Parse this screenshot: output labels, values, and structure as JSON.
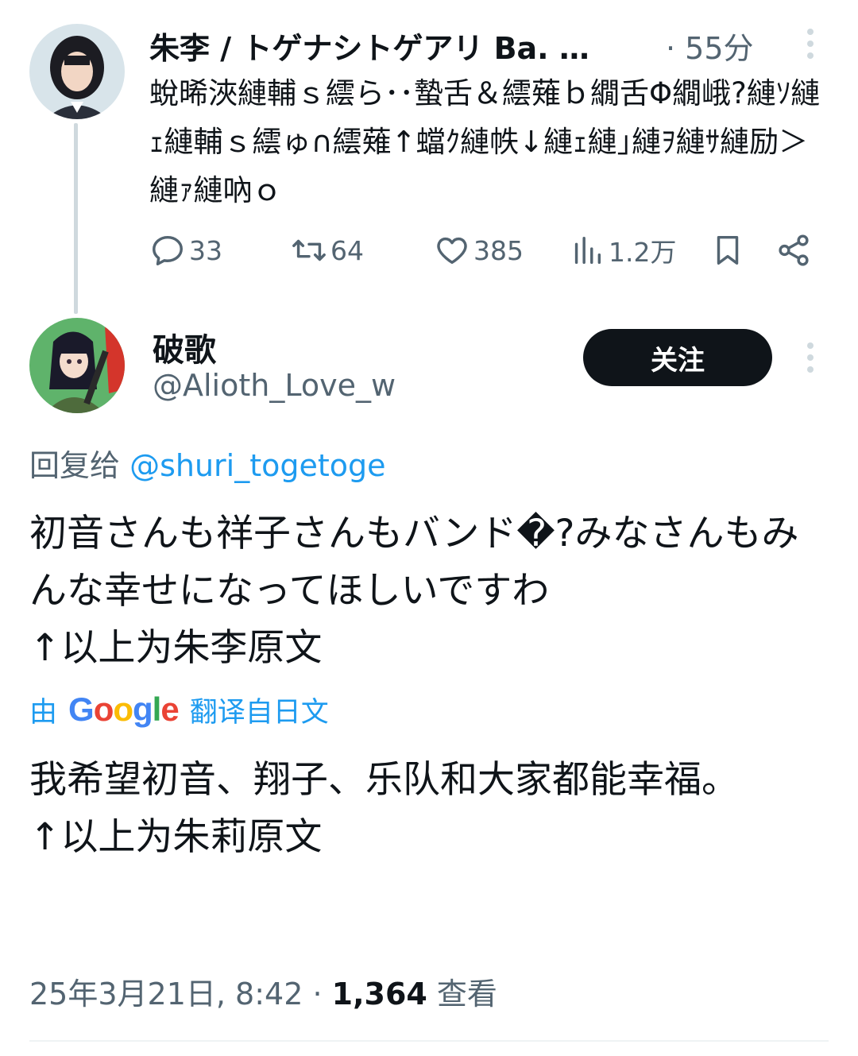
{
  "parent_tweet": {
    "author_name": "朱李 / トゲナシトゲアリ Ba. …",
    "time": "· 55分",
    "avatar_icon": "user-avatar-photo",
    "body": "蛻晞浹縺輔ｓ繧ら･･蟄舌＆繧薙ｂ繝舌Φ繝峨?縺ｿ縺ｪ縺輔ｓ繧ゅ∩繧薙↑蟷ｸ縺帙↓縺ｪ縺｣縺ｦ縺ｻ縺励＞縺ｧ縺吶ｏ",
    "stats": {
      "replies": "33",
      "retweets": "64",
      "likes": "385",
      "views": "1.2万"
    }
  },
  "reply_tweet": {
    "author_name": "破歌",
    "handle": "@Alioth_Love_w",
    "follow_label": "关注",
    "avatar_icon": "anime-avatar-image",
    "reply_prefix": "回复给 ",
    "reply_mention": "@shuri_togetoge",
    "body": "初音さんも祥子さんもバンド�?みなさんもみんな幸せになってほしいですわ\n↑以上为朱李原文",
    "translate_prefix": "由",
    "translate_brand": "Google",
    "translate_suffix": "翻译自日文",
    "translated_body": "我希望初音、翔子、乐队和大家都能幸福。\n↑以上为朱莉原文",
    "date": "25年3月21日, 8:42 · ",
    "views_count": "1,364",
    "views_label": " 查看"
  },
  "colors": {
    "text_primary": "#0f1419",
    "text_secondary": "#536471",
    "link": "#1d9bf0",
    "thread_line": "#cfd9de"
  }
}
